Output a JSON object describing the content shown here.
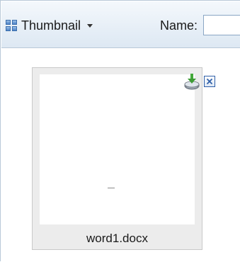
{
  "toolbar": {
    "view_label": "Thumbnail",
    "name_label": "Name:",
    "name_value": ""
  },
  "files": [
    {
      "name": "word1.docx"
    }
  ],
  "icons": {
    "view": "grid-view-icon",
    "view_dropdown": "caret-down-icon",
    "download": "download-icon",
    "delete": "close-icon"
  },
  "colors": {
    "accent": "#3b6eac",
    "toolbar_top": "#f4f8fc",
    "toolbar_bottom": "#dde8f3",
    "card_background": "#ececec",
    "card_border": "#c9c9c9"
  }
}
